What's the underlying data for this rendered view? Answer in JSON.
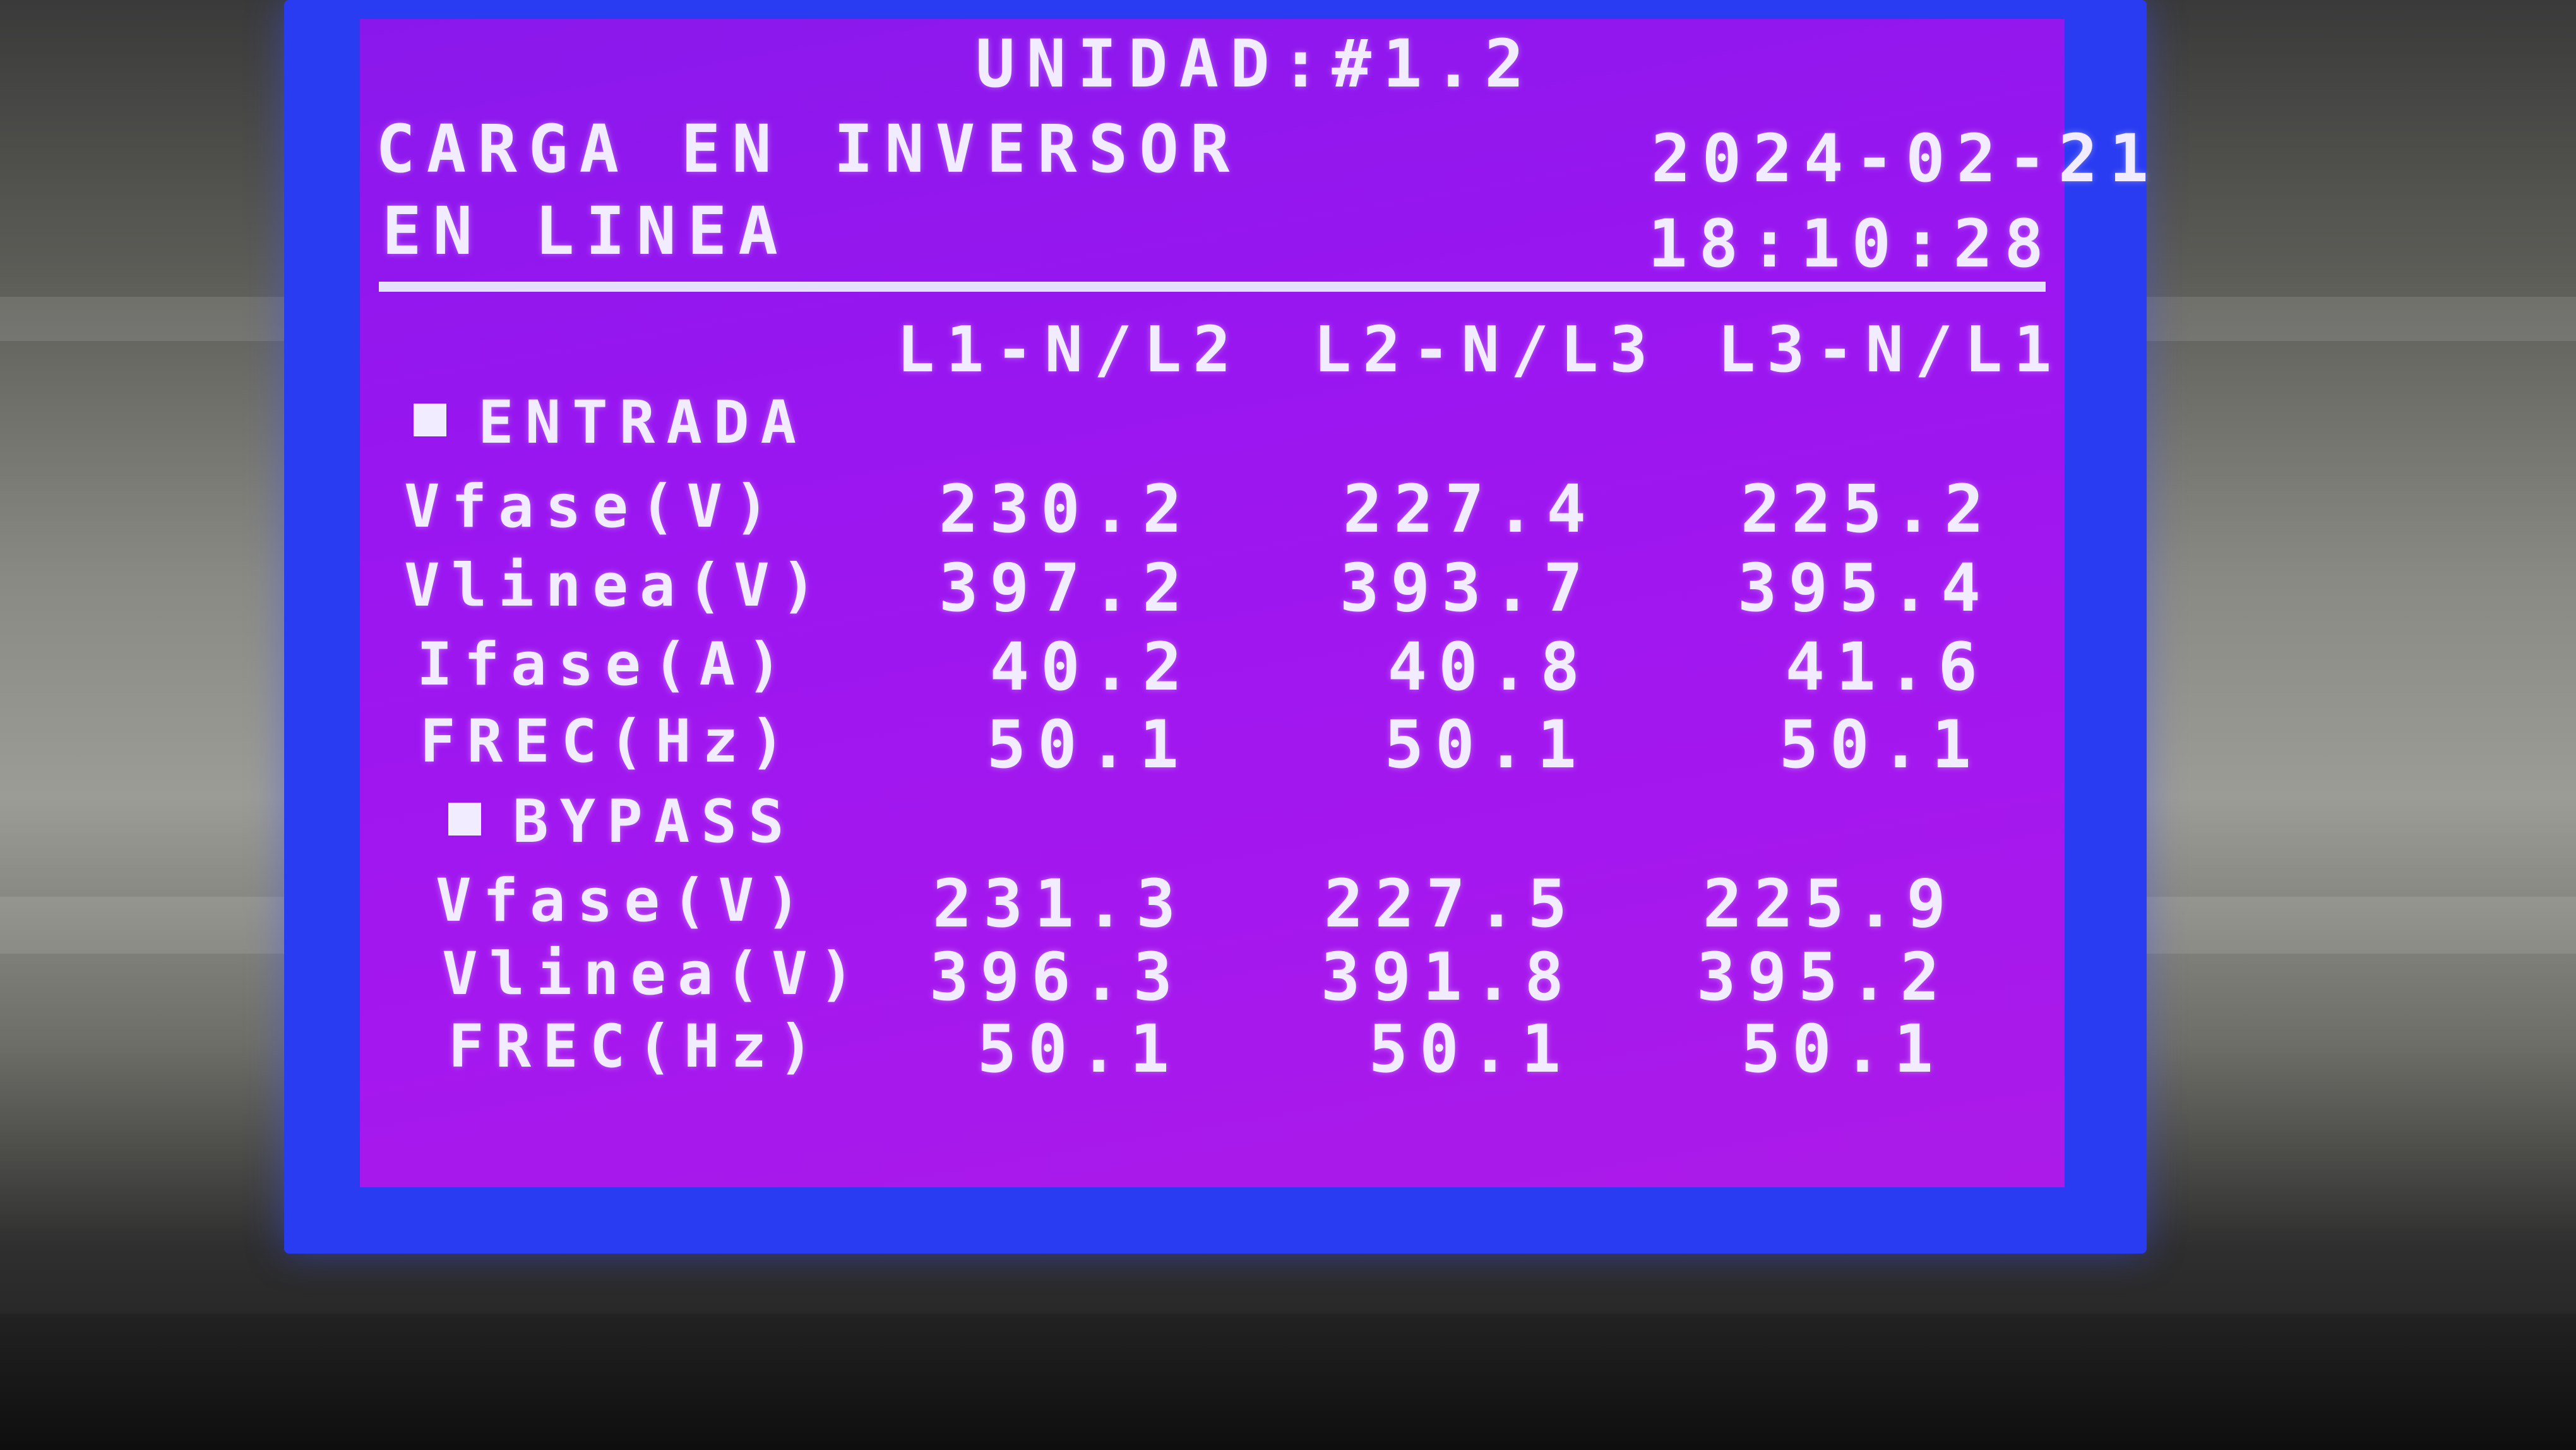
{
  "header": {
    "unit": "UNIDAD:#1.2",
    "mode": "CARGA EN INVERSOR",
    "status": "EN LINEA",
    "date": "2024-02-21",
    "time": "18:10:28"
  },
  "columns": [
    "L1-N/L2",
    "L2-N/L3",
    "L3-N/L1"
  ],
  "entrada": {
    "title": "ENTRADA",
    "rows": [
      {
        "label": "Vfase(V)",
        "values": [
          "230.2",
          "227.4",
          "225.2"
        ]
      },
      {
        "label": "Vlinea(V)",
        "values": [
          "397.2",
          "393.7",
          "395.4"
        ]
      },
      {
        "label": "Ifase(A)",
        "values": [
          "40.2",
          "40.8",
          "41.6"
        ]
      },
      {
        "label": "FREC(Hz)",
        "values": [
          "50.1",
          "50.1",
          "50.1"
        ]
      }
    ]
  },
  "bypass": {
    "title": "BYPASS",
    "rows": [
      {
        "label": "Vfase(V)",
        "values": [
          "231.3",
          "227.5",
          "225.9"
        ]
      },
      {
        "label": "Vlinea(V)",
        "values": [
          "396.3",
          "391.8",
          "395.2"
        ]
      },
      {
        "label": "FREC(Hz)",
        "values": [
          "50.1",
          "50.1",
          "50.1"
        ]
      }
    ]
  },
  "colors": {
    "lcd_frame": "#2a3cf2",
    "lcd_background": "#9a16f0",
    "lcd_text": "#f1ecff"
  }
}
